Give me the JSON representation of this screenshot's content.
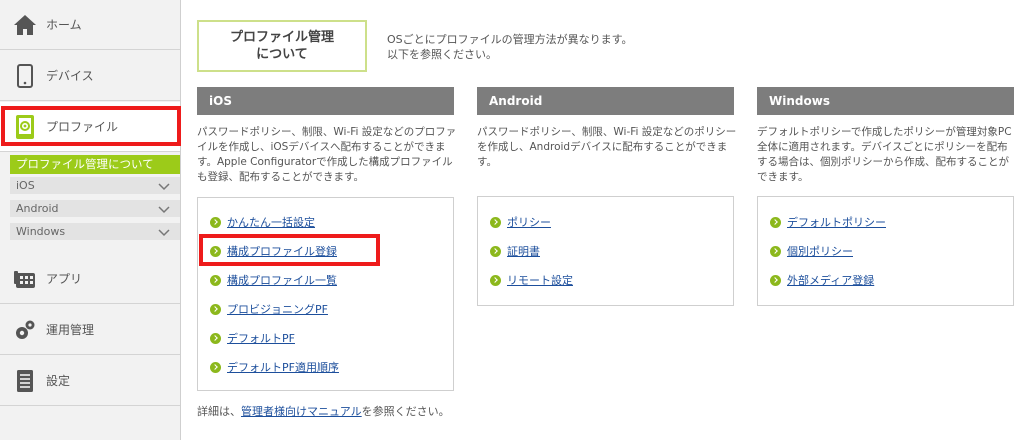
{
  "sidebar": {
    "items": [
      {
        "label": "ホーム",
        "icon": "home-icon"
      },
      {
        "label": "デバイス",
        "icon": "device-icon"
      },
      {
        "label": "プロファイル",
        "icon": "profile-icon"
      },
      {
        "label": "アプリ",
        "icon": "app-icon"
      },
      {
        "label": "運用管理",
        "icon": "gear-icon"
      },
      {
        "label": "設定",
        "icon": "settings-list-icon"
      }
    ],
    "profile_submenu": {
      "active": "プロファイル管理について",
      "items": [
        "iOS",
        "Android",
        "Windows"
      ]
    }
  },
  "main": {
    "about_title_line1": "プロファイル管理",
    "about_title_line2": "について",
    "about_text_line1": "OSごとにプロファイルの管理方法が異なります。",
    "about_text_line2": "以下を参照ください。",
    "columns": [
      {
        "title": "iOS",
        "desc": "パスワードポリシー、制限、Wi-Fi 設定などのプロファイルを作成し、iOSデバイスへ配布することができます。Apple Configuratorで作成した構成プロファイルも登録、配布することができます。",
        "links": [
          "かんたん一括設定",
          "構成プロファイル登録",
          "構成プロファイル一覧",
          "プロビジョニングPF",
          "デフォルトPF",
          "デフォルトPF適用順序"
        ]
      },
      {
        "title": "Android",
        "desc": "パスワードポリシー、制限、Wi-Fi 設定などのポリシーを作成し、Androidデバイスに配布することができます。",
        "links": [
          "ポリシー",
          "証明書",
          "リモート設定"
        ]
      },
      {
        "title": "Windows",
        "desc": "デフォルトポリシーで作成したポリシーが管理対象PC全体に適用されます。デバイスごとにポリシーを配布する場合は、個別ポリシーから作成、配布することができます。",
        "links": [
          "デフォルトポリシー",
          "個別ポリシー",
          "外部メディア登録"
        ]
      }
    ],
    "footer_prefix": "詳細は、",
    "footer_link": "管理者様向けマニュアル",
    "footer_suffix": "を参照ください。"
  },
  "colors": {
    "accent_green": "#9ccb19",
    "header_gray": "#7d7d7d",
    "link_blue": "#1d4f9c",
    "highlight_red": "#ee1b1b"
  }
}
